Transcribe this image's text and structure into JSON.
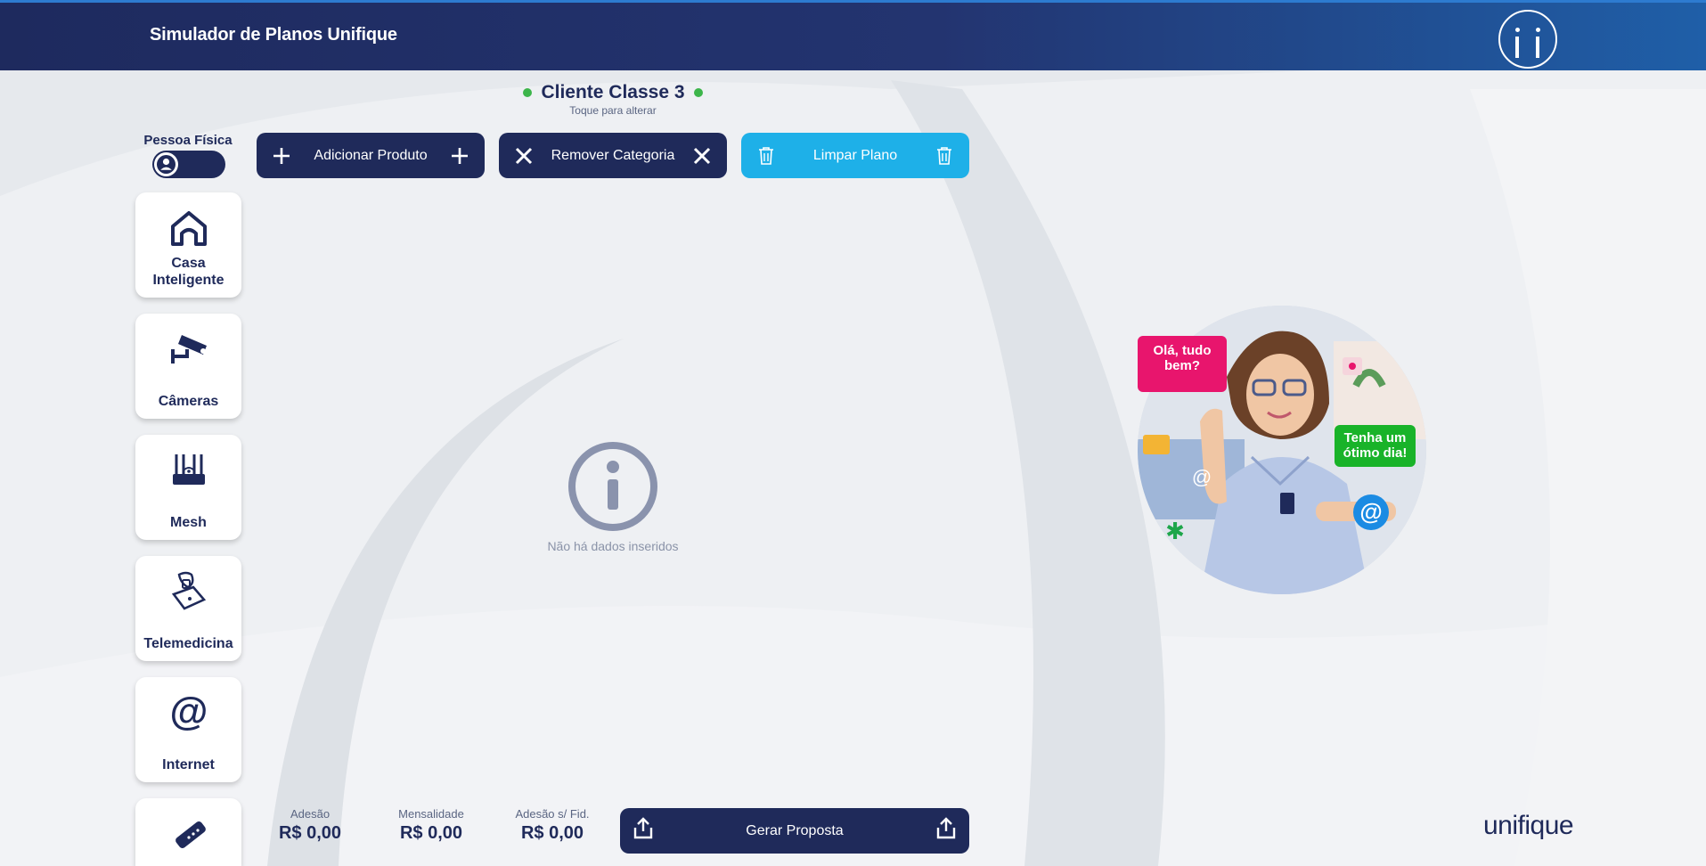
{
  "header": {
    "title": "Simulador de Planos Unifique",
    "info_icon": "info-icon"
  },
  "client": {
    "class_name": "Cliente Classe 3",
    "hint": "Toque para alterar"
  },
  "person_type": {
    "label": "Pessoa Física",
    "icon": "user-icon"
  },
  "actions": {
    "add_product": "Adicionar Produto",
    "remove_category": "Remover Categoria",
    "clear_plan": "Limpar Plano"
  },
  "categories": [
    {
      "label": "Casa Inteligente",
      "icon": "house-icon"
    },
    {
      "label": "Câmeras",
      "icon": "camera-icon"
    },
    {
      "label": "Mesh",
      "icon": "router-icon"
    },
    {
      "label": "Telemedicina",
      "icon": "telemedicine-icon"
    },
    {
      "label": "Internet",
      "icon": "at-icon"
    },
    {
      "label": "",
      "icon": "remote-control-icon"
    }
  ],
  "empty_state": {
    "icon": "info-icon",
    "message": "Não há dados inseridos"
  },
  "assistant": {
    "bubble_greeting": "Olá, tudo bem?",
    "bubble_wish": "Tenha um ótimo dia!"
  },
  "totals": {
    "adesao_label": "Adesão",
    "adesao_value": "R$ 0,00",
    "mensalidade_label": "Mensalidade",
    "mensalidade_value": "R$ 0,00",
    "adesao_sf_label": "Adesão s/ Fid.",
    "adesao_sf_value": "R$ 0,00"
  },
  "proposal": {
    "label": "Gerar Proposta"
  },
  "brand": {
    "logo_text": "unifique"
  },
  "colors": {
    "navy": "#1f2a5a",
    "cyan": "#1eb0e8",
    "green": "#3cb54a",
    "pink": "#e8156d"
  }
}
